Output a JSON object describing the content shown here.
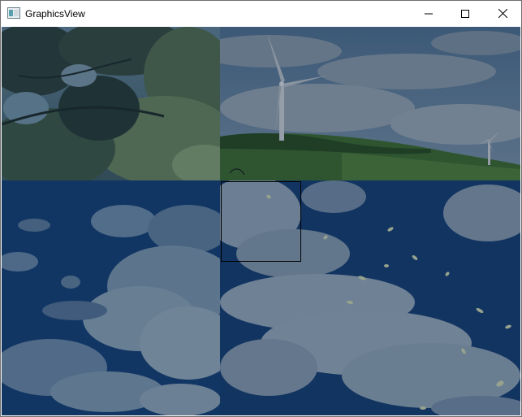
{
  "window": {
    "title": "GraphicsView",
    "icon": "qt-window-icon",
    "controls": {
      "minimize_icon": "minimize-icon",
      "maximize_icon": "maximize-icon",
      "close_icon": "close-icon"
    }
  },
  "scene": {
    "tiles": [
      {
        "name": "forest-leaves-tile",
        "subject": "leaves"
      },
      {
        "name": "wind-turbines-tile",
        "subject": "turbines"
      },
      {
        "name": "blue-sky-clouds-tile",
        "subject": "clouds"
      },
      {
        "name": "sky-falling-leaves-tile",
        "subject": "clouds-leaves"
      }
    ],
    "selection": {
      "shape": "rectangle",
      "color": "#000000"
    }
  },
  "colors": {
    "sky_dark": "#14325a",
    "cloud": "#8ea0b4",
    "leaf_dark": "#243a33",
    "leaf_light": "#6e8a62",
    "grass": "#3e6a2e"
  }
}
